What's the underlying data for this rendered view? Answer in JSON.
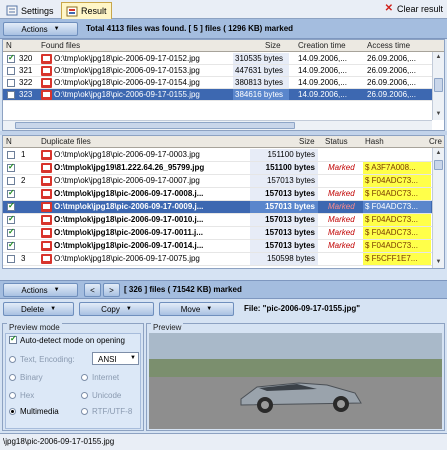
{
  "tabs": [
    {
      "label": "Settings",
      "active": false
    },
    {
      "label": "Result",
      "active": true
    }
  ],
  "clear_result_label": "Clear result",
  "actions_label": "Actions",
  "top_info": "Total 4113 files was found. [ 5 ] files ( 1296 KB) marked",
  "found_table": {
    "headers": [
      "N",
      "Found files",
      "Size",
      "Creation time",
      "Access time"
    ],
    "rows": [
      {
        "n": "320",
        "checked": true,
        "name": "O:\\tmp\\ok\\jpg18\\pic-2006-09-17-0152.jpg",
        "size": "310535 bytes",
        "created": "14.09.2006,...",
        "accessed": "26.09.2006,...",
        "selected": false
      },
      {
        "n": "321",
        "checked": false,
        "name": "O:\\tmp\\ok\\jpg18\\pic-2006-09-17-0153.jpg",
        "size": "447631 bytes",
        "created": "14.09.2006,...",
        "accessed": "26.09.2006,...",
        "selected": false
      },
      {
        "n": "322",
        "checked": false,
        "name": "O:\\tmp\\ok\\jpg18\\pic-2006-09-17-0154.jpg",
        "size": "380813 bytes",
        "created": "14.09.2006,...",
        "accessed": "26.09.2006,...",
        "selected": false
      },
      {
        "n": "323",
        "checked": false,
        "name": "O:\\tmp\\ok\\jpg18\\pic-2006-09-17-0155.jpg",
        "size": "384616 bytes",
        "created": "14.09.2006,...",
        "accessed": "26.09.2006,...",
        "selected": true
      }
    ]
  },
  "dup_table": {
    "headers": [
      "N",
      "Duplicate files",
      "Size",
      "Status",
      "Hash",
      "Cre"
    ],
    "rows": [
      {
        "n": "1",
        "checked": false,
        "name": "O:\\tmp\\ok\\jpg18\\pic-2006-09-17-0003.jpg",
        "size": "151100 bytes",
        "status": "",
        "hash": "",
        "bold": false,
        "selected": false
      },
      {
        "n": "",
        "checked": true,
        "name": "O:\\tmp\\ok\\jpg19\\81.222.64.26_95799.jpg",
        "size": "151100 bytes",
        "status": "Marked",
        "hash": "$ A3F7A008...",
        "bold": true,
        "selected": false
      },
      {
        "n": "2",
        "checked": false,
        "name": "O:\\tmp\\ok\\jpg18\\pic-2006-09-17-0007.jpg",
        "size": "157013 bytes",
        "status": "",
        "hash": "$ F04ADC73...",
        "bold": false,
        "selected": false
      },
      {
        "n": "",
        "checked": true,
        "name": "O:\\tmp\\ok\\jpg18\\pic-2006-09-17-0008.j...",
        "size": "157013 bytes",
        "status": "Marked",
        "hash": "$ F04ADC73...",
        "bold": true,
        "selected": false
      },
      {
        "n": "",
        "checked": true,
        "name": "O:\\tmp\\ok\\jpg18\\pic-2006-09-17-0009.j...",
        "size": "157013 bytes",
        "status": "Marked",
        "hash": "$ F04ADC73...",
        "bold": true,
        "selected": true
      },
      {
        "n": "",
        "checked": true,
        "name": "O:\\tmp\\ok\\jpg18\\pic-2006-09-17-0010.j...",
        "size": "157013 bytes",
        "status": "Marked",
        "hash": "$ F04ADC73...",
        "bold": true,
        "selected": false
      },
      {
        "n": "",
        "checked": true,
        "name": "O:\\tmp\\ok\\jpg18\\pic-2006-09-17-0011.j...",
        "size": "157013 bytes",
        "status": "Marked",
        "hash": "$ F04ADC73...",
        "bold": true,
        "selected": false
      },
      {
        "n": "",
        "checked": true,
        "name": "O:\\tmp\\ok\\jpg18\\pic-2006-09-17-0014.j...",
        "size": "157013 bytes",
        "status": "Marked",
        "hash": "$ F04ADC73...",
        "bold": true,
        "selected": false
      },
      {
        "n": "3",
        "checked": false,
        "name": "O:\\tmp\\ok\\jpg18\\pic-2006-09-17-0075.jpg",
        "size": "150598 bytes",
        "status": "",
        "hash": "$ F5CFF1E7...",
        "bold": false,
        "selected": false
      }
    ]
  },
  "mid_info": "[ 326 ] files ( 71542 KB) marked",
  "nav_prev": "<",
  "nav_next": ">",
  "delete_label": "Delete",
  "copy_label": "Copy",
  "move_label": "Move",
  "file_label": "File: \"pic-2006-09-17-0155.jpg\"",
  "preview_mode": {
    "title": "Preview mode",
    "auto_detect": "Auto-detect mode on opening",
    "auto_detect_checked": true,
    "text_encoding": "Text, Encoding:",
    "encoding_value": "ANSI",
    "binary": "Binary",
    "internet": "Internet",
    "hex": "Hex",
    "unicode": "Unicode",
    "multimedia": "Multimedia",
    "rtf": "RTF/UTF-8",
    "selected": "multimedia"
  },
  "preview_title": "Preview",
  "status_path": "\\jpg18\\pic-2006-09-17-0155.jpg",
  "colors": {
    "selection": "#3d68b1",
    "hash_highlight": "#ffff4a",
    "marked_text": "#c00000",
    "panel_bg": "#d6e3f3"
  }
}
